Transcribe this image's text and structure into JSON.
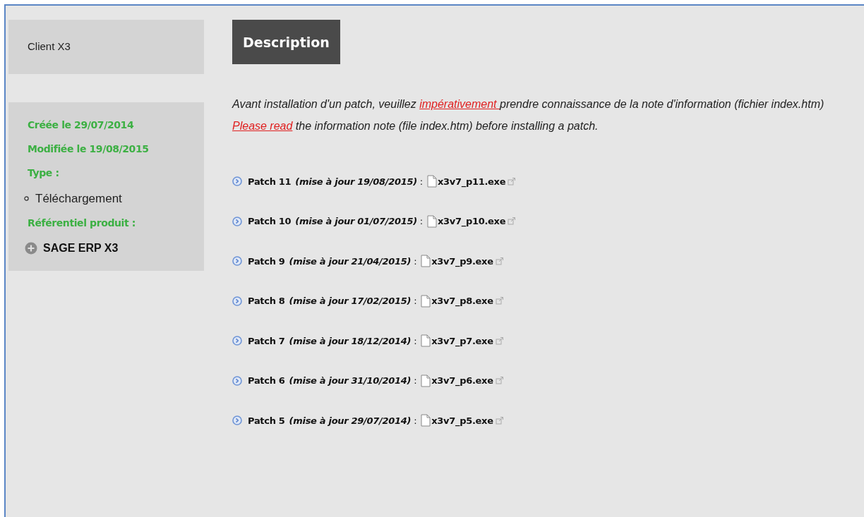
{
  "sidebar": {
    "title": "Client X3",
    "created": "Créée le 29/07/2014",
    "modified": "Modifiée le 19/08/2015",
    "type_label": "Type :",
    "types": [
      "Téléchargement"
    ],
    "product_label": "Référentiel produit :",
    "products": [
      {
        "label": "SAGE ERP X3",
        "expanded": false
      }
    ]
  },
  "heading": "Description",
  "notes": [
    {
      "before": "Avant installation d'un patch, veuillez ",
      "link": "impérativement ",
      "after": "prendre connaissance de la note d'information (fichier index.htm)"
    },
    {
      "link": "Please read",
      "after": " the information note (file index.htm) before installing a patch."
    }
  ],
  "patches": [
    {
      "label": "Patch 11",
      "update": "(mise à jour 19/08/2015)",
      "separator": ":",
      "file": "x3v7_p11.exe"
    },
    {
      "label": "Patch 10",
      "update": "(mise à jour 01/07/2015)",
      "separator": ":",
      "file": "x3v7_p10.exe"
    },
    {
      "label": "Patch 9",
      "update": "(mise à jour 21/04/2015)",
      "separator": ":",
      "file": "x3v7_p9.exe"
    },
    {
      "label": "Patch 8",
      "update": "(mise à jour 17/02/2015)",
      "separator": ":",
      "file": "x3v7_p8.exe"
    },
    {
      "label": "Patch 7",
      "update": "(mise à jour 18/12/2014)",
      "separator": ":",
      "file": "x3v7_p7.exe"
    },
    {
      "label": "Patch 6",
      "update": "(mise à jour 31/10/2014)",
      "separator": ":",
      "file": "x3v7_p6.exe"
    },
    {
      "label": "Patch 5",
      "update": "(mise à jour 29/07/2014)",
      "separator": ":",
      "file": "x3v7_p5.exe"
    }
  ]
}
